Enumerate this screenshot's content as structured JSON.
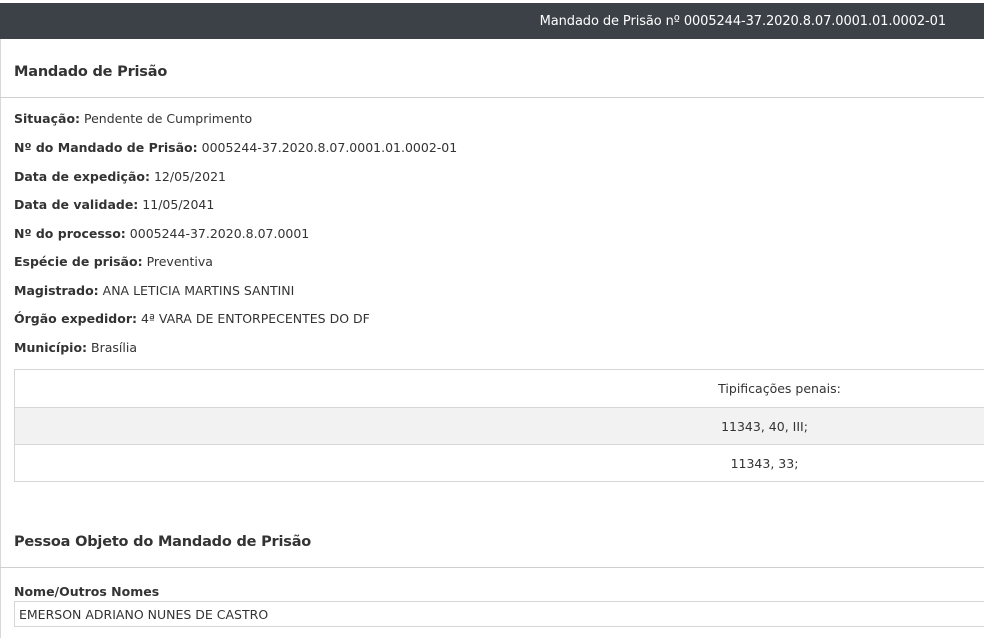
{
  "header": {
    "title": "Mandado de Prisão nº 0005244-37.2020.8.07.0001.01.0002-01"
  },
  "warrant_section": {
    "title": "Mandado de Prisão",
    "fields": [
      {
        "label": "Situação:",
        "value": "Pendente de Cumprimento"
      },
      {
        "label": "Nº do Mandado de Prisão:",
        "value": "0005244-37.2020.8.07.0001.01.0002-01"
      },
      {
        "label": "Data de expedição:",
        "value": "12/05/2021"
      },
      {
        "label": "Data de validade:",
        "value": "11/05/2041"
      },
      {
        "label": "Nº do processo:",
        "value": "0005244-37.2020.8.07.0001"
      },
      {
        "label": "Espécie de prisão:",
        "value": "Preventiva"
      },
      {
        "label": "Magistrado:",
        "value": "ANA LETICIA MARTINS SANTINI"
      },
      {
        "label": "Órgão expedidor:",
        "value": "4ª VARA DE ENTORPECENTES DO DF"
      },
      {
        "label": "Município:",
        "value": "Brasília"
      }
    ],
    "tipificacoes": {
      "header": "Tipificações penais:",
      "rows": [
        "11343, 40, III;",
        "11343, 33;"
      ]
    }
  },
  "person_section": {
    "title": "Pessoa Objeto do Mandado de Prisão",
    "name_label": "Nome/Outros Nomes",
    "name_value": "EMERSON ADRIANO NUNES DE CASTRO"
  },
  "colors": {
    "header_bg": "#3b4146",
    "text": "#333333",
    "row_shade": "#f2f2f2",
    "border": "#d6d6d6"
  }
}
